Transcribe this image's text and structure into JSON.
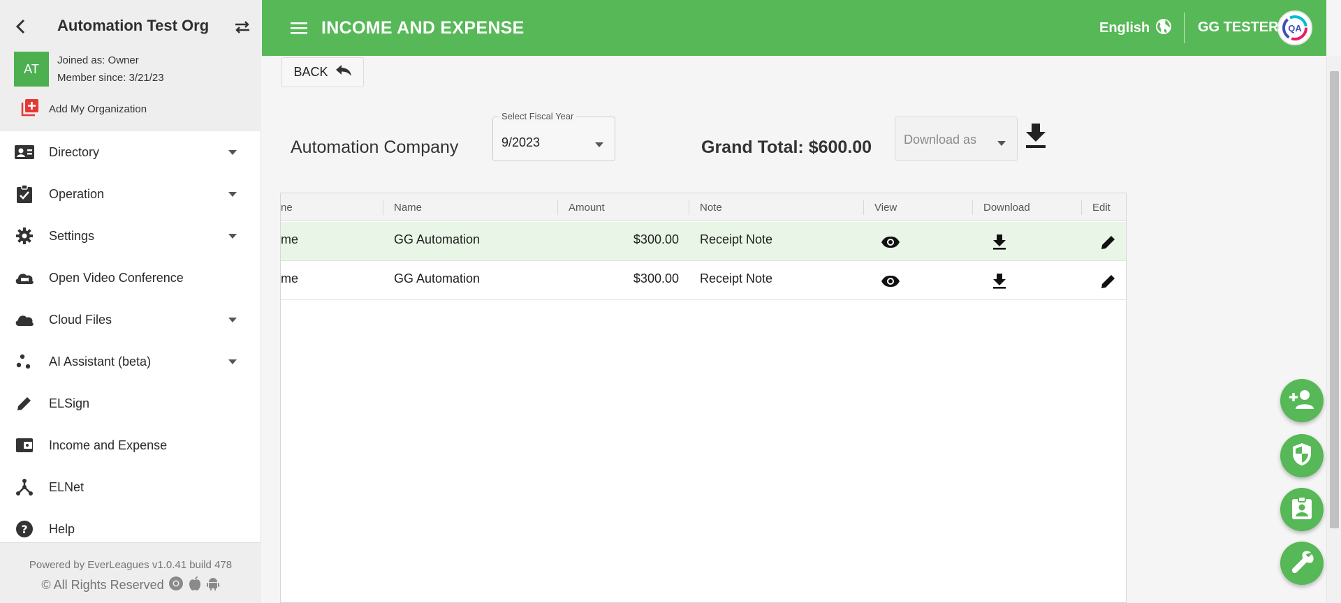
{
  "sidebar": {
    "org_name": "Automation Test Org",
    "avatar_initials": "AT",
    "joined_as": "Joined as: Owner",
    "member_since": "Member since: 3/21/23",
    "add_org_label": "Add My Organization",
    "items": [
      {
        "label": "Directory",
        "icon": "contact-card-icon",
        "has_caret": true
      },
      {
        "label": "Operation",
        "icon": "clipboard-check-icon",
        "has_caret": true
      },
      {
        "label": "Settings",
        "icon": "gear-icon",
        "has_caret": true
      },
      {
        "label": "Open Video Conference",
        "icon": "cloud-video-icon",
        "has_caret": false
      },
      {
        "label": "Cloud Files",
        "icon": "cloud-icon",
        "has_caret": true
      },
      {
        "label": "AI Assistant (beta)",
        "icon": "scatter-dots-icon",
        "has_caret": true
      },
      {
        "label": "ELSign",
        "icon": "pencil-icon",
        "has_caret": false
      },
      {
        "label": "Income and Expense",
        "icon": "wallet-icon",
        "has_caret": false
      },
      {
        "label": "ELNet",
        "icon": "network-icon",
        "has_caret": false
      },
      {
        "label": "Help",
        "icon": "help-circle-icon",
        "has_caret": false
      }
    ],
    "footer": {
      "powered_by": "Powered by EverLeagues v1.0.41 build 478",
      "rights": "© All Rights Reserved"
    }
  },
  "header": {
    "title": "INCOME AND EXPENSE",
    "language": "English",
    "user_name": "GG TESTER",
    "user_avatar_text": "QA"
  },
  "main": {
    "back_label": "BACK",
    "company_name": "Automation Company",
    "fiscal_year": {
      "label": "Select Fiscal Year",
      "value": "9/2023"
    },
    "grand_total": "Grand Total: $600.00",
    "download_select": {
      "placeholder": "Download as"
    },
    "table": {
      "columns": [
        {
          "key": "type",
          "label": "ne"
        },
        {
          "key": "name",
          "label": "Name"
        },
        {
          "key": "amount",
          "label": "Amount"
        },
        {
          "key": "note",
          "label": "Note"
        },
        {
          "key": "view",
          "label": "View"
        },
        {
          "key": "download",
          "label": "Download"
        },
        {
          "key": "edit",
          "label": "Edit"
        }
      ],
      "rows": [
        {
          "type": "me",
          "name": "GG Automation",
          "amount": "$300.00",
          "note": "Receipt Note"
        },
        {
          "type": "me",
          "name": "GG Automation",
          "amount": "$300.00",
          "note": "Receipt Note"
        }
      ]
    }
  },
  "fabs": [
    "add-person-icon",
    "shield-icon",
    "contact-badge-icon",
    "wrench-icon"
  ],
  "colors": {
    "primary": "#56b856",
    "highlight_row": "#e9f6e7",
    "add_org_red": "#e53935"
  }
}
